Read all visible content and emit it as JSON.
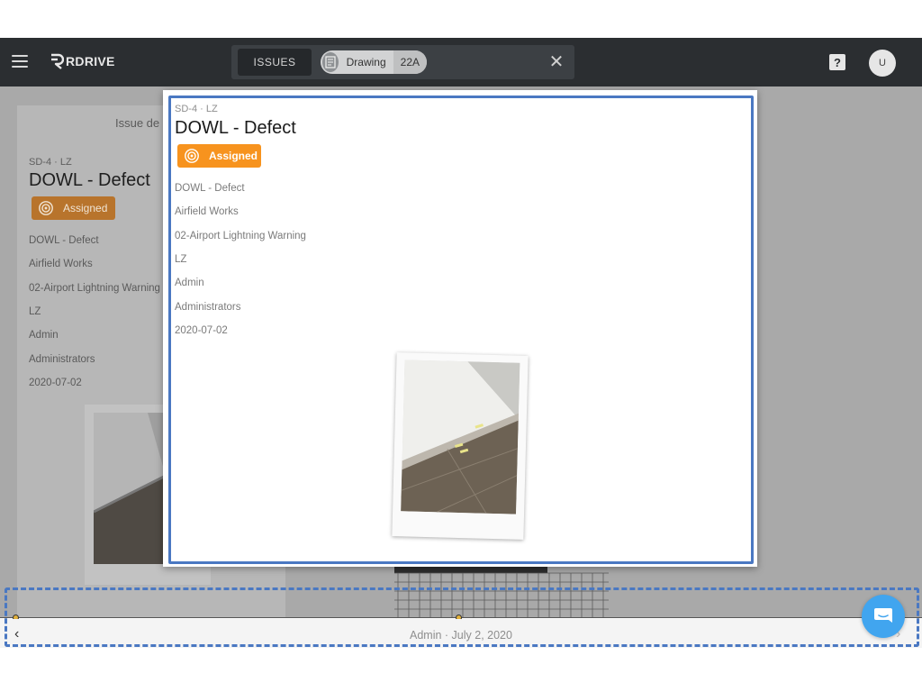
{
  "app": {
    "brand": "RDRIVE"
  },
  "header": {
    "tab_issues": "ISSUES",
    "chip_label": "Drawing",
    "chip_count": "22A",
    "avatar_initial": "U"
  },
  "background_panel": {
    "title": "Issue de",
    "code": "SD-4 · LZ",
    "name": "DOWL - Defect",
    "status": "Assigned",
    "fields": [
      "DOWL - Defect",
      "Airfield Works",
      "02-Airport Lightning Warning",
      "LZ",
      "Admin",
      "Administrators",
      "2020-07-02"
    ]
  },
  "issue_card": {
    "code": "SD-4 · LZ",
    "name": "DOWL - Defect",
    "status": "Assigned",
    "fields": [
      "DOWL - Defect",
      "Airfield Works",
      "02-Airport Lightning Warning",
      "LZ",
      "Admin",
      "Administrators",
      "2020-07-02"
    ]
  },
  "footer": {
    "meta": "Admin · July 2, 2020"
  },
  "colors": {
    "topbar": "#2b2e31",
    "status_assigned": "#f7931e",
    "highlight_frame": "#4a78c2",
    "chat_button": "#41a5ef"
  },
  "icons": {
    "menu": "hamburger-icon",
    "close": "close-icon",
    "help": "help-icon",
    "status": "assigned-status-icon",
    "prev": "chevron-left-icon",
    "next": "chevron-right-icon",
    "chat": "chat-icon"
  }
}
